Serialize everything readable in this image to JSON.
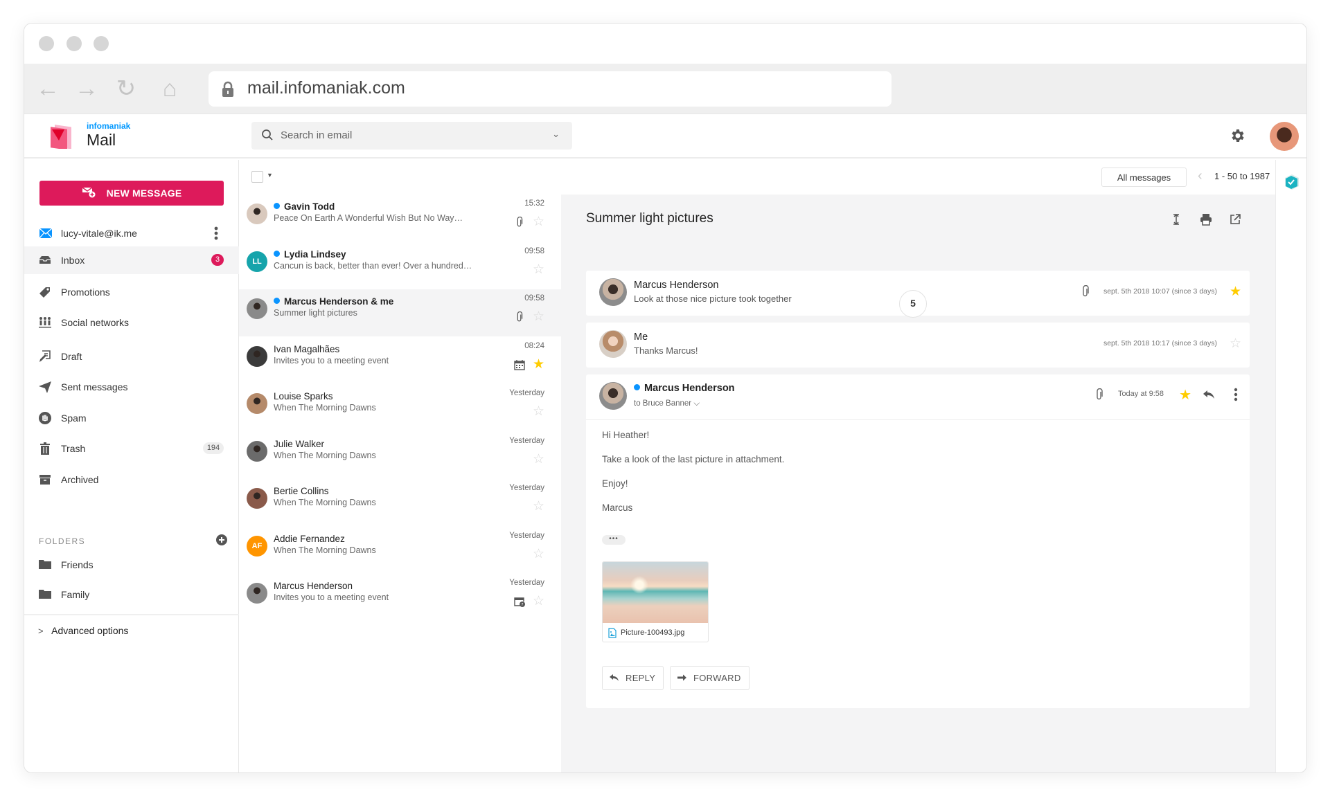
{
  "browser": {
    "url": "mail.infomaniak.com",
    "nav": {
      "back": "←",
      "forward": "→",
      "reload": "↻",
      "home": "⌂"
    }
  },
  "header": {
    "brand_small": "infomaniak",
    "app_name": "Mail",
    "search_placeholder": "Search in email",
    "search_chevron": "⌄"
  },
  "sidebar": {
    "new_message_label": "NEW MESSAGE",
    "account": "lucy-vitale@ik.me",
    "items": [
      {
        "label": "Inbox",
        "icon": "inbox-icon",
        "badge": "3",
        "active": true
      },
      {
        "label": "Promotions",
        "icon": "tag-icon"
      },
      {
        "label": "Social networks",
        "icon": "people-icon"
      },
      {
        "label": "Draft",
        "icon": "draft-icon"
      },
      {
        "label": "Sent messages",
        "icon": "send-icon"
      },
      {
        "label": "Spam",
        "icon": "spam-hand-icon"
      },
      {
        "label": "Trash",
        "icon": "trash-icon",
        "badge": "194"
      },
      {
        "label": "Archived",
        "icon": "archive-icon"
      }
    ],
    "folders_label": "FOLDERS",
    "folders": [
      {
        "label": "Friends"
      },
      {
        "label": "Family"
      }
    ],
    "advanced_label": "Advanced options"
  },
  "toolbar": {
    "filter_label": "All messages",
    "page_range": "1 - 50 to 1987"
  },
  "messages": [
    {
      "from": "Gavin Todd",
      "subject": "Peace On Earth A Wonderful Wish But No Way…",
      "time": "15:32",
      "unread": true,
      "attachment": true,
      "starred": false,
      "avatar": "photo",
      "avatar_color": "#d9c9bd"
    },
    {
      "from": "Lydia Lindsey",
      "subject": "Cancun is back, better than ever! Over a hundred…",
      "time": "09:58",
      "unread": true,
      "starred": false,
      "avatar": "initials",
      "initials": "LL",
      "avatar_color": "#16a4ab"
    },
    {
      "from": "Marcus Henderson & me",
      "subject": "Summer light pictures",
      "time": "09:58",
      "unread": true,
      "attachment": true,
      "starred": false,
      "selected": true,
      "avatar": "photo",
      "avatar_color": "#8a8a8a"
    },
    {
      "from": "Ivan Magalhães",
      "subject": "Invites you to a meeting event",
      "time": "08:24",
      "starred": true,
      "event": "calendar",
      "avatar": "photo",
      "avatar_color": "#3b3b3b"
    },
    {
      "from": "Louise Sparks",
      "subject": "When The Morning Dawns",
      "time": "Yesterday",
      "starred": false,
      "avatar": "photo",
      "avatar_color": "#b58a6a"
    },
    {
      "from": "Julie Walker",
      "subject": "When The Morning Dawns",
      "time": "Yesterday",
      "starred": false,
      "avatar": "photo",
      "avatar_color": "#6b6b6b"
    },
    {
      "from": "Bertie Collins",
      "subject": "When The Morning Dawns",
      "time": "Yesterday",
      "starred": false,
      "avatar": "photo",
      "avatar_color": "#8a5a4a"
    },
    {
      "from": "Addie Fernandez",
      "subject": "When The Morning Dawns",
      "time": "Yesterday",
      "starred": false,
      "avatar": "initials",
      "initials": "AF",
      "avatar_color": "#ff9500"
    },
    {
      "from": "Marcus Henderson",
      "subject": "Invites you to a meeting event",
      "time": "Yesterday",
      "starred": false,
      "event": "calendar-question",
      "avatar": "photo",
      "avatar_color": "#8a8a8a"
    }
  ],
  "reader": {
    "title": "Summer light pictures",
    "thread_count": "5",
    "collapsed": [
      {
        "from": "Marcus Henderson",
        "snippet": "Look at those nice picture took together",
        "date": "sept. 5th 2018 10:07 (since 3 days)",
        "attachment": true,
        "starred": true
      },
      {
        "from": "Me",
        "snippet": "Thanks Marcus!",
        "date": "sept. 5th 2018 10:17 (since 3 days)",
        "attachment": false,
        "starred": false
      }
    ],
    "open": {
      "from": "Marcus Henderson",
      "to": "to Bruce Banner",
      "time": "Today at 9:58",
      "starred": true,
      "body": [
        "Hi Heather!",
        "Take a look of the last picture in attachment.",
        "Enjoy!",
        "Marcus"
      ],
      "more_label": "•••",
      "attachment_name": "Picture-100493.jpg",
      "reply_label": "REPLY",
      "forward_label": "FORWARD"
    }
  },
  "colors": {
    "accent": "#dd1a5b",
    "unread_dot": "#0a94ff",
    "star": "#ffcc00",
    "brand_blue": "#0098ff"
  }
}
